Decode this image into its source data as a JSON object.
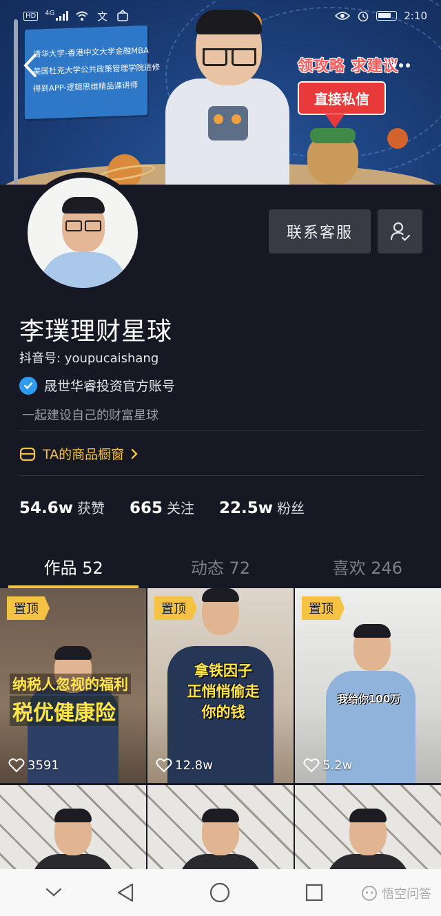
{
  "status_bar": {
    "time": "2:10",
    "network": "4G",
    "hd": "HD"
  },
  "banner": {
    "flag_lines": [
      "清华大学-香港中文大学金融MBA",
      "美国杜克大学公共政策管理学院进修",
      "得到APP-逻辑思维精品课讲师"
    ],
    "promo_line": "领攻略  求建议",
    "promo_button": "直接私信"
  },
  "profile": {
    "nickname": "李璞理财星球",
    "douyin_id": "抖音号: youpucaishang",
    "verified_text": "晟世华睿投资官方账号",
    "bio": "一起建设自己的财富星球",
    "shop_link": "TA的商品橱窗",
    "contact_button": "联系客服"
  },
  "stats": [
    {
      "value": "54.6w",
      "label": "获赞"
    },
    {
      "value": "665",
      "label": "关注"
    },
    {
      "value": "22.5w",
      "label": "粉丝"
    }
  ],
  "tabs": [
    {
      "label": "作品 52",
      "active": true
    },
    {
      "label": "动态 72",
      "active": false
    },
    {
      "label": "喜欢 246",
      "active": false
    }
  ],
  "videos": [
    {
      "pinned": "置顶",
      "likes": "3591",
      "caption_top": "纳税人忽视的福利",
      "caption_main": "税优健康险"
    },
    {
      "pinned": "置顶",
      "likes": "12.8w",
      "caption_lines": [
        "拿铁因子",
        "正悄悄偷走",
        "你的钱"
      ]
    },
    {
      "pinned": "置顶",
      "likes": "5.2w",
      "caption": "我给你100万"
    }
  ],
  "watermark": "悟空问答",
  "colors": {
    "background": "#161823",
    "accent_yellow": "#f5c244",
    "verified_blue": "#2d9cf0",
    "button_bg": "#393b44"
  }
}
